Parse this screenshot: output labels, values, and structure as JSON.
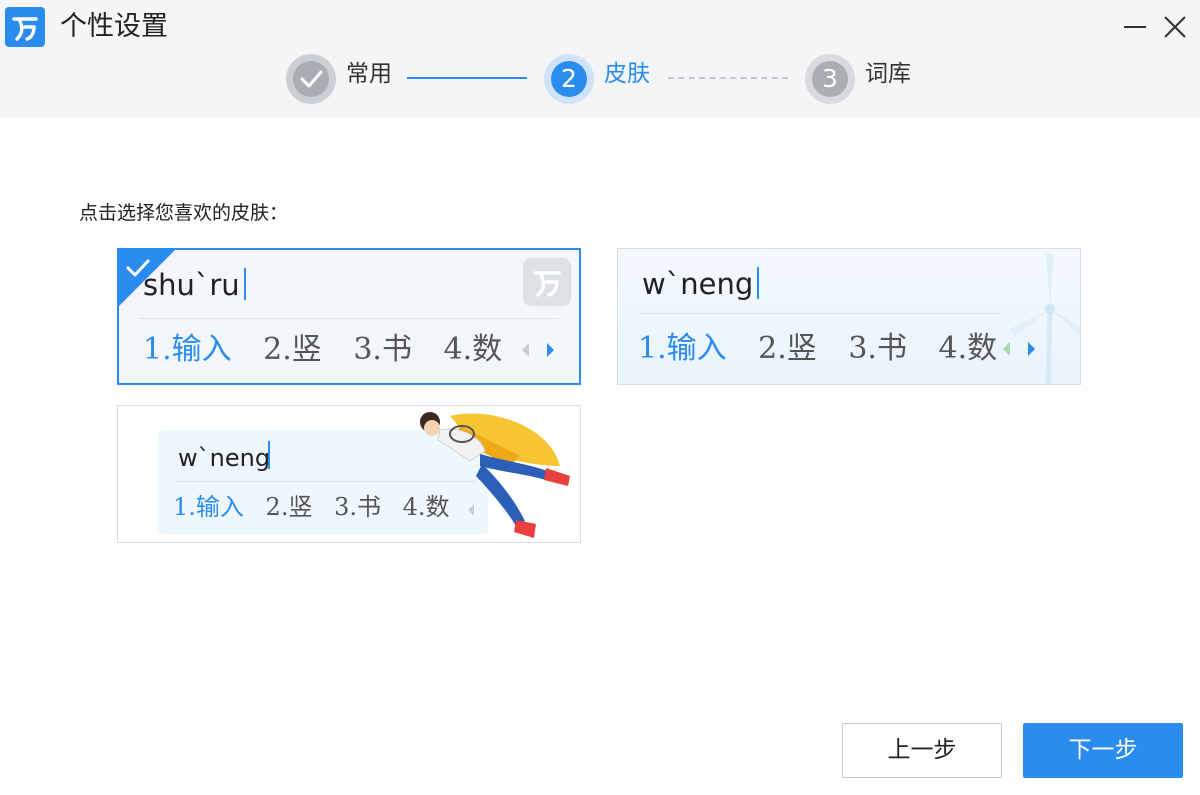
{
  "window": {
    "title": "个性设置",
    "minimize_icon": "minimize-icon",
    "close_icon": "close-icon"
  },
  "steps": [
    {
      "number": "1",
      "label": "常用",
      "state": "completed"
    },
    {
      "number": "2",
      "label": "皮肤",
      "state": "active"
    },
    {
      "number": "3",
      "label": "词库",
      "state": "pending"
    }
  ],
  "instruction": "点击选择您喜欢的皮肤：",
  "skins": [
    {
      "pinyin": "shu`ru",
      "candidates": [
        "1.输入",
        "2.竖",
        "3.书",
        "4.数"
      ],
      "selected": true
    },
    {
      "pinyin": "w`neng",
      "candidates": [
        "1.输入",
        "2.竖",
        "3.书",
        "4.数"
      ],
      "selected": false
    },
    {
      "pinyin": "w`neng",
      "candidates": [
        "1.输入",
        "2.竖",
        "3.书",
        "4.数"
      ],
      "selected": false
    }
  ],
  "buttons": {
    "prev": "上一步",
    "next": "下一步"
  },
  "colors": {
    "accent": "#2b8cf0",
    "completed_step": "#cbced4",
    "pending_step": "#a9adb4"
  }
}
